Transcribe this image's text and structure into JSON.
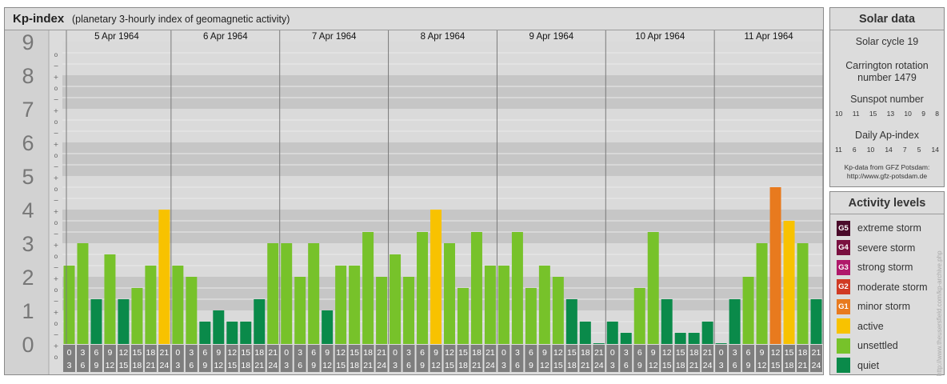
{
  "header": {
    "title": "Kp-index",
    "subtitle": "(planetary 3-hourly index of geomagnetic activity)"
  },
  "chart_data": {
    "type": "bar",
    "title": "Kp-index",
    "subtitle": "(planetary 3-hourly index of geomagnetic activity)",
    "ylim": [
      0,
      9
    ],
    "y_ticks": [
      "0",
      "1",
      "2",
      "3",
      "4",
      "5",
      "6",
      "7",
      "8",
      "9"
    ],
    "sub_ticks": [
      "o",
      "+",
      "−",
      "o",
      "+",
      "−",
      "o",
      "+",
      "−",
      "o",
      "+",
      "−",
      "o",
      "+",
      "−",
      "o",
      "+",
      "−",
      "o",
      "+",
      "−",
      "o",
      "+",
      "−",
      "o",
      "+",
      "−",
      "o"
    ],
    "days": [
      "5 Apr 1964",
      "6 Apr 1964",
      "7 Apr 1964",
      "8 Apr 1964",
      "9 Apr 1964",
      "10 Apr 1964",
      "11 Apr 1964"
    ],
    "interval_start": [
      "0",
      "3",
      "6",
      "9",
      "12",
      "15",
      "18",
      "21"
    ],
    "interval_end": [
      "3",
      "6",
      "9",
      "12",
      "15",
      "18",
      "21",
      "24"
    ],
    "values": [
      [
        2.333,
        3.0,
        1.333,
        2.667,
        1.333,
        1.667,
        2.333,
        4.0
      ],
      [
        2.333,
        2.0,
        0.667,
        1.0,
        0.667,
        0.667,
        1.333,
        3.0
      ],
      [
        3.0,
        2.0,
        3.0,
        1.0,
        2.333,
        2.333,
        3.333,
        2.0
      ],
      [
        2.667,
        2.0,
        3.333,
        4.0,
        3.0,
        1.667,
        3.333,
        2.333
      ],
      [
        2.333,
        3.333,
        1.667,
        2.333,
        2.0,
        1.333,
        0.667,
        0.0
      ],
      [
        0.667,
        0.333,
        1.667,
        3.333,
        1.333,
        0.333,
        0.333,
        0.667
      ],
      [
        0.0,
        1.333,
        2.0,
        3.0,
        4.667,
        3.667,
        3.0,
        1.333
      ]
    ],
    "levels": [
      {
        "max": 1.5,
        "color": "#0a8a4a"
      },
      {
        "max": 3.5,
        "color": "#77c22a"
      },
      {
        "max": 4.5,
        "color": "#f8c200"
      },
      {
        "max": 5.5,
        "color": "#e87a1e"
      }
    ],
    "grid": true
  },
  "solar": {
    "title": "Solar data",
    "cycle": "Solar cycle 19",
    "carrington_line1": "Carrington rotation",
    "carrington_line2": "number 1479",
    "sunspot_label": "Sunspot number",
    "sunspot_values": [
      "10",
      "11",
      "15",
      "13",
      "10",
      "9",
      "8"
    ],
    "ap_label": "Daily Ap-index",
    "ap_values": [
      "11",
      "6",
      "10",
      "14",
      "7",
      "5",
      "14"
    ],
    "source_line1": "Kp-data from GFZ Potsdam:",
    "source_line2": "http://www.gfz-potsdam.de"
  },
  "activity": {
    "title": "Activity levels",
    "items": [
      {
        "badge": "G5",
        "label": "extreme storm",
        "color": "#4a0a2a"
      },
      {
        "badge": "G4",
        "label": "severe storm",
        "color": "#7a1040"
      },
      {
        "badge": "G3",
        "label": "strong storm",
        "color": "#b0186a"
      },
      {
        "badge": "G2",
        "label": "moderate storm",
        "color": "#d03a24"
      },
      {
        "badge": "G1",
        "label": "minor storm",
        "color": "#e87a1e"
      },
      {
        "badge": "",
        "label": "active",
        "color": "#f8c200"
      },
      {
        "badge": "",
        "label": "unsettled",
        "color": "#77c22a"
      },
      {
        "badge": "",
        "label": "quiet",
        "color": "#0a8a4a"
      }
    ]
  },
  "watermark": "http://www.theusersfield.com/kp-archive.php"
}
